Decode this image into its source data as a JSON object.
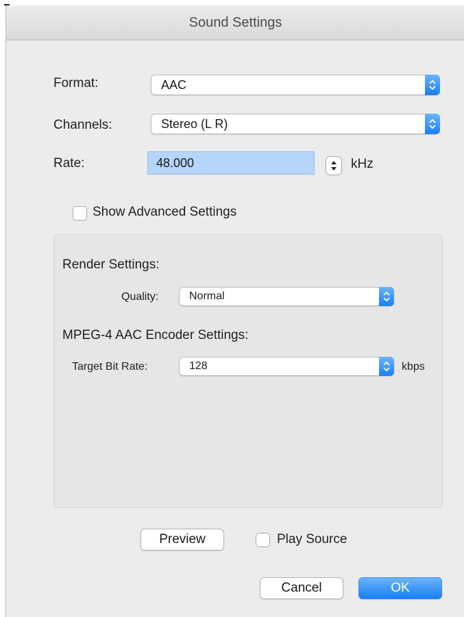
{
  "window": {
    "title": "Sound Settings"
  },
  "fields": {
    "format": {
      "label": "Format:",
      "value": "AAC"
    },
    "channels": {
      "label": "Channels:",
      "value": "Stereo (L R)"
    },
    "rate": {
      "label": "Rate:",
      "value": "48.000",
      "unit": "kHz"
    }
  },
  "advanced": {
    "checkbox_label": "Show Advanced Settings",
    "render_heading": "Render Settings:",
    "quality_label": "Quality:",
    "quality_value": "Normal",
    "encoder_heading": "MPEG-4 AAC Encoder Settings:",
    "bitrate_label": "Target Bit Rate:",
    "bitrate_value": "128",
    "bitrate_unit": "kbps"
  },
  "preview": {
    "button_label": "Preview",
    "play_source_label": "Play Source"
  },
  "buttons": {
    "cancel_label": "Cancel",
    "ok_label": "OK"
  },
  "colors": {
    "accent": "#1a7ef6",
    "selection": "#b5d5fb"
  }
}
